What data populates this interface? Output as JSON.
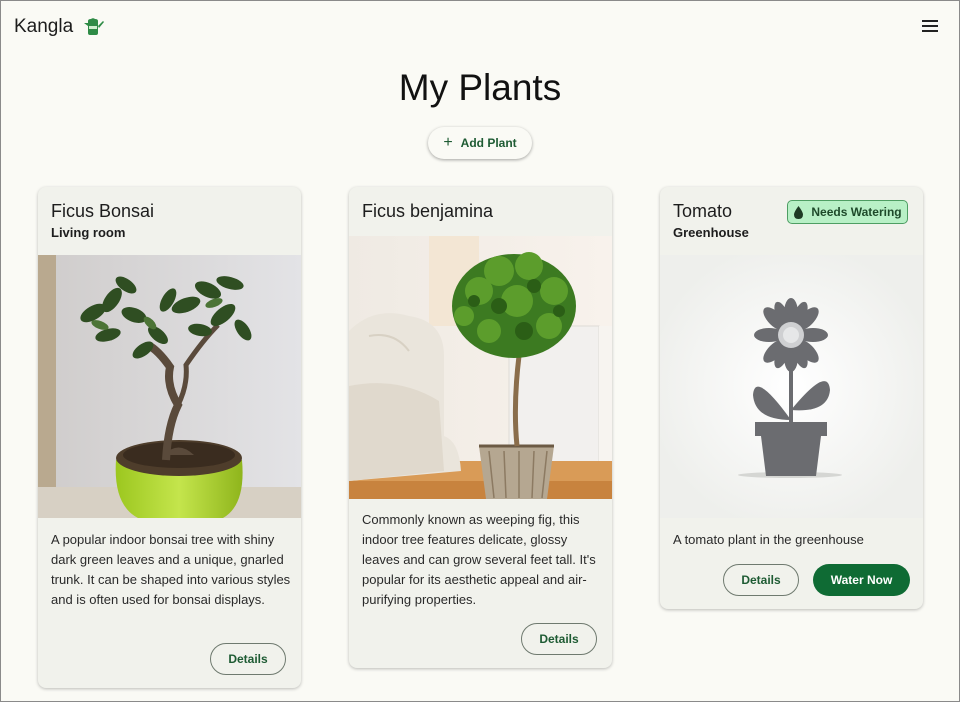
{
  "app": {
    "name": "Kangla",
    "logo_icon": "watering-can-icon",
    "menu_icon": "hamburger-menu-icon"
  },
  "page": {
    "title": "My Plants",
    "add_button": "Add Plant",
    "add_icon": "plus-icon"
  },
  "colors": {
    "primary": "#0f6b34",
    "badge_bg": "#b8f0c6",
    "card_bg": "#f1f2ec",
    "page_bg": "#fafaf5"
  },
  "plants": [
    {
      "name": "Ficus Bonsai",
      "location": "Living room",
      "description": "A popular indoor bonsai tree with shiny dark green leaves and a unique, gnarled trunk. It can be shaped into various styles and is often used for bonsai displays.",
      "details_label": "Details",
      "image": "bonsai-photo"
    },
    {
      "name": "Ficus benjamina",
      "location": "",
      "description": "Commonly known as weeping fig, this indoor tree features delicate, glossy leaves and can grow several feet tall. It's popular for its aesthetic appeal and air-purifying properties.",
      "details_label": "Details",
      "image": "weeping-fig-photo"
    },
    {
      "name": "Tomato",
      "location": "Greenhouse",
      "description": "A tomato plant in the greenhouse",
      "details_label": "Details",
      "water_label": "Water Now",
      "badge": "Needs Watering",
      "badge_icon": "water-drop-icon",
      "image": "placeholder-flower-icon"
    }
  ]
}
